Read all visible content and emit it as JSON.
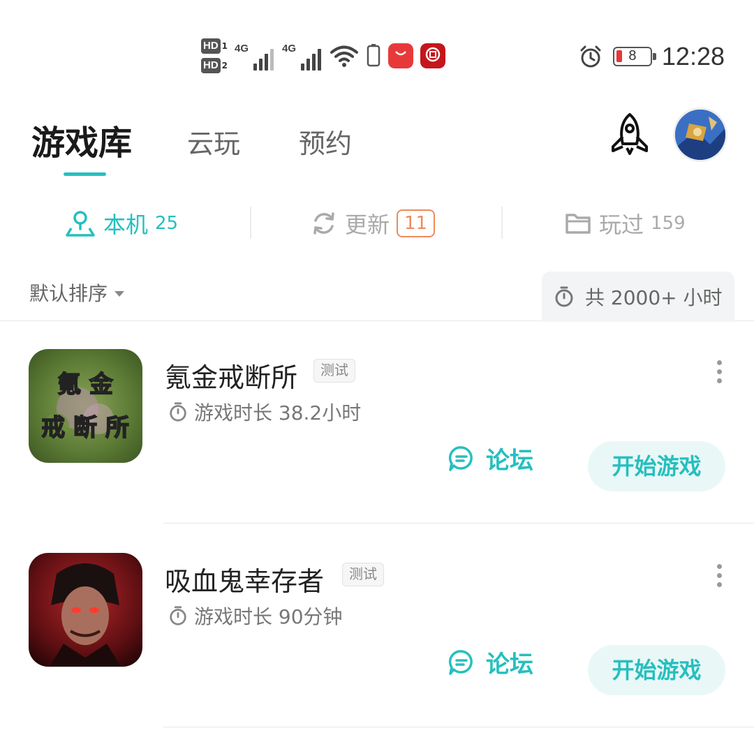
{
  "status_bar": {
    "hd1": "HD",
    "hd1_num": "1",
    "hd2": "HD",
    "hd2_num": "2",
    "net1": "4G",
    "net2": "4G",
    "battery": "8",
    "time": "12:28"
  },
  "header": {
    "tabs": [
      {
        "label": "游戏库"
      },
      {
        "label": "云玩"
      },
      {
        "label": "预约"
      }
    ],
    "accent": "#26bfbf"
  },
  "filters": [
    {
      "label": "本机",
      "count": "25"
    },
    {
      "label": "更新",
      "count": "11"
    },
    {
      "label": "玩过",
      "count": "159"
    }
  ],
  "sort": {
    "label": "默认排序",
    "total_time": "共 2000+ 小时"
  },
  "games": [
    {
      "title": "氪金戒断所",
      "tag": "测试",
      "playtime": "游戏时长 38.2小时",
      "icon_line1": "氪 金",
      "icon_line2": "戒 断 所",
      "forum": "论坛",
      "start": "开始游戏"
    },
    {
      "title": "吸血鬼幸存者",
      "tag": "测试",
      "playtime": "游戏时长 90分钟",
      "forum": "论坛",
      "start": "开始游戏"
    }
  ]
}
